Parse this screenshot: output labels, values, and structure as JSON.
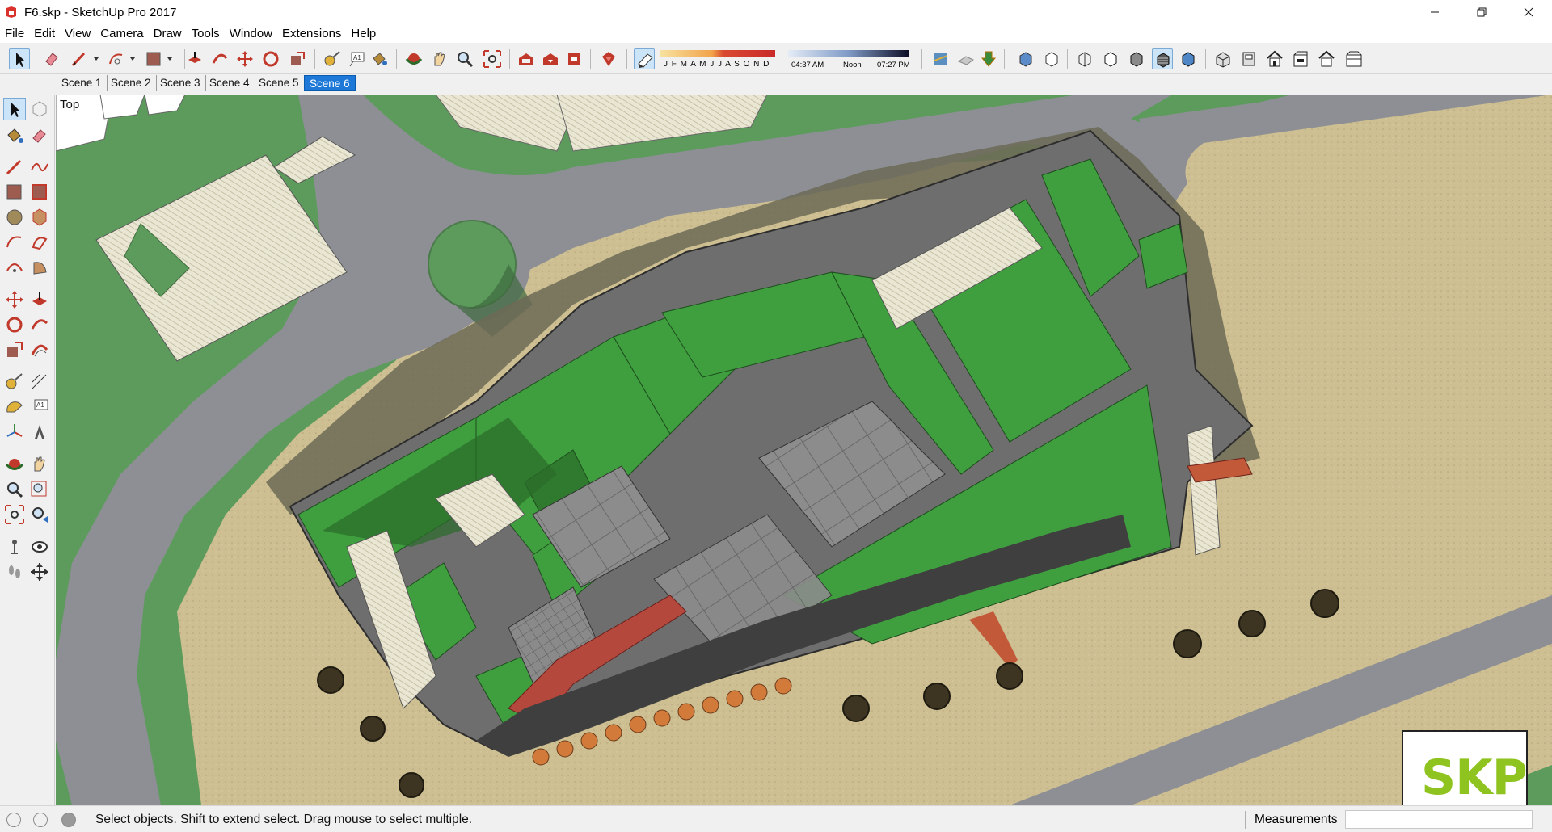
{
  "window": {
    "title": "F6.skp - SketchUp Pro 2017",
    "controls": [
      "minimize-icon",
      "restore-icon",
      "close-icon"
    ]
  },
  "menu": [
    "File",
    "Edit",
    "View",
    "Camera",
    "Draw",
    "Tools",
    "Window",
    "Extensions",
    "Help"
  ],
  "shadow_settings": {
    "months": "J F M A M J J A S O N D",
    "time_start": "04:37 AM",
    "time_noon": "Noon",
    "time_end": "07:27 PM"
  },
  "scenes": {
    "tabs": [
      "Scene 1",
      "Scene 2",
      "Scene 3",
      "Scene 4",
      "Scene 5",
      "Scene 6"
    ],
    "active": "Scene 6"
  },
  "viewport": {
    "view_name": "Top",
    "badge": "SKP"
  },
  "status": {
    "message": "Select objects. Shift to extend select. Drag mouse to select multiple.",
    "measurements_label": "Measurements",
    "measurements_value": ""
  },
  "colors": {
    "accent_tab": "#1e78d7",
    "roof_green": "#3f9f3f",
    "ground_sand": "#c9bb8c",
    "grass": "#5f9a5f",
    "road": "#8e9096",
    "badge_green": "#8fc31f"
  }
}
